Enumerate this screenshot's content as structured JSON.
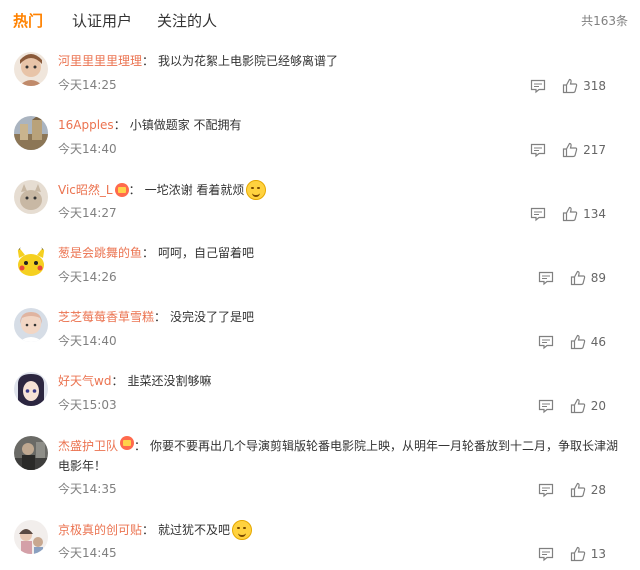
{
  "tabs": {
    "hot": "热门",
    "certified": "认证用户",
    "following": "关注的人"
  },
  "total_label": "共163条",
  "colors": {
    "accent": "#ff8200",
    "username": "#eb7350",
    "muted": "#808080"
  },
  "comments": [
    {
      "user": "河里里里里理理",
      "text": "我以为花絮上电影院已经够离谱了",
      "time": "今天14:25",
      "likes": "318",
      "avatar_color": "#b77d5a"
    },
    {
      "user": "16Apples",
      "text": "小镇做题家 不配拥有",
      "time": "今天14:40",
      "likes": "217",
      "avatar_color": "#9c8a6a"
    },
    {
      "user": "Vic昭然_L",
      "text": "一坨浓谢 看着就烦",
      "time": "今天14:27",
      "likes": "134",
      "avatar_color": "#d9c9b6"
    },
    {
      "user": "葱是会跳舞的鱼",
      "text": "呵呵，自己留着吧",
      "time": "今天14:26",
      "likes": "89",
      "avatar_color": "#f5d020"
    },
    {
      "user": "芝芝莓莓香草雪糕",
      "text": "没完没了了是吧",
      "time": "今天14:40",
      "likes": "46",
      "avatar_color": "#e8cbb8"
    },
    {
      "user": "好天气wd",
      "text": "韭菜还没割够嘛",
      "time": "今天15:03",
      "likes": "20",
      "avatar_color": "#3a3550"
    },
    {
      "user": "杰盛护卫队",
      "text": "你要不要再出几个导演剪辑版轮番电影院上映，从明年一月轮番放到十二月，争取长津湖电影年！",
      "time": "今天14:35",
      "likes": "28",
      "avatar_color": "#4a4a48"
    },
    {
      "user": "京极真的创可贴",
      "text": "就过犹不及吧",
      "time": "今天14:45",
      "likes": "13",
      "avatar_color": "#e0d6d0"
    }
  ]
}
